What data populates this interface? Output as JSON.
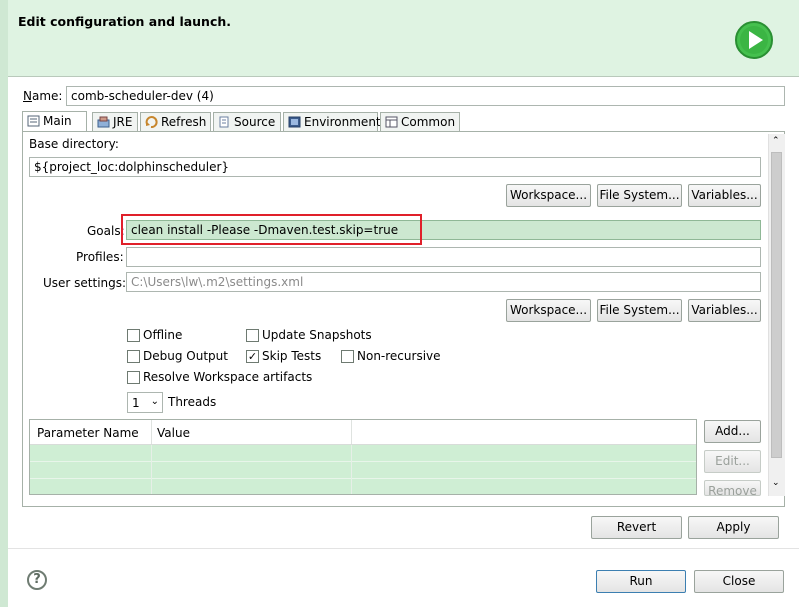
{
  "dialog": {
    "title": "Edit configuration and launch."
  },
  "name": {
    "label": "Name:",
    "value": "comb-scheduler-dev (4)"
  },
  "tabs": [
    {
      "label": "Main",
      "icon": "main-icon"
    },
    {
      "label": "JRE",
      "icon": "jre-icon"
    },
    {
      "label": "Refresh",
      "icon": "refresh-icon"
    },
    {
      "label": "Source",
      "icon": "source-icon"
    },
    {
      "label": "Environment",
      "icon": "environment-icon"
    },
    {
      "label": "Common",
      "icon": "common-icon"
    }
  ],
  "base_dir": {
    "label": "Base directory:",
    "value": "${project_loc:dolphinscheduler}"
  },
  "buttons": {
    "workspace": "Workspace...",
    "file_system": "File System...",
    "variables": "Variables..."
  },
  "goals": {
    "label": "Goals:",
    "value": "clean install -Please -Dmaven.test.skip=true"
  },
  "profiles": {
    "label": "Profiles:",
    "value": ""
  },
  "user_settings": {
    "label": "User settings:",
    "placeholder": "C:\\Users\\lw\\.m2\\settings.xml"
  },
  "options": {
    "offline": {
      "label": "Offline",
      "checked": false
    },
    "update_snapshots": {
      "label": "Update Snapshots",
      "checked": false
    },
    "debug_output": {
      "label": "Debug Output",
      "checked": false
    },
    "skip_tests": {
      "label": "Skip Tests",
      "checked": true,
      "mark": "✓"
    },
    "non_recursive": {
      "label": "Non-recursive",
      "checked": false
    },
    "resolve_workspace": {
      "label": "Resolve Workspace artifacts",
      "checked": false
    }
  },
  "threads": {
    "value": "1",
    "label": "Threads"
  },
  "params_table": {
    "columns": [
      "Parameter Name",
      "Value"
    ]
  },
  "param_buttons": {
    "add": "Add...",
    "edit": "Edit...",
    "remove": "Remove"
  },
  "footer": {
    "revert": "Revert",
    "apply": "Apply",
    "run": "Run",
    "close": "Close",
    "help": "?"
  },
  "colors": {
    "header_bg": "#dff3e2",
    "highlight": "#cce8d0",
    "focus_border": "#e0202a",
    "run_icon": "#2fae3c"
  }
}
